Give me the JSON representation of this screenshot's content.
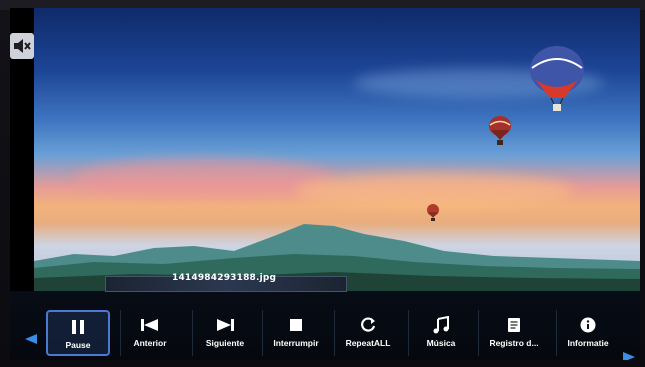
{
  "screen": {
    "filename": "1414984293188.jpg",
    "mute_icon": "speaker-mute-icon"
  },
  "toolbar": {
    "buttons": [
      {
        "label": "Pause",
        "icon": "pause-icon",
        "active": true
      },
      {
        "label": "Anterior",
        "icon": "previous-icon",
        "active": false
      },
      {
        "label": "Siguiente",
        "icon": "next-icon",
        "active": false
      },
      {
        "label": "Interrumpir",
        "icon": "stop-icon",
        "active": false
      },
      {
        "label": "RepeatALL",
        "icon": "repeat-icon",
        "active": false
      },
      {
        "label": "Música",
        "icon": "music-note-icon",
        "active": false
      },
      {
        "label": "Registro d...",
        "icon": "document-icon",
        "active": false
      },
      {
        "label": "Informatie",
        "icon": "info-icon",
        "active": false
      }
    ],
    "left_arrow": "scroll-left-arrow-icon",
    "right_arrow": "scroll-right-arrow-icon"
  },
  "colors": {
    "accent": "#4a7bd0",
    "arrow": "#3a8ee6"
  }
}
